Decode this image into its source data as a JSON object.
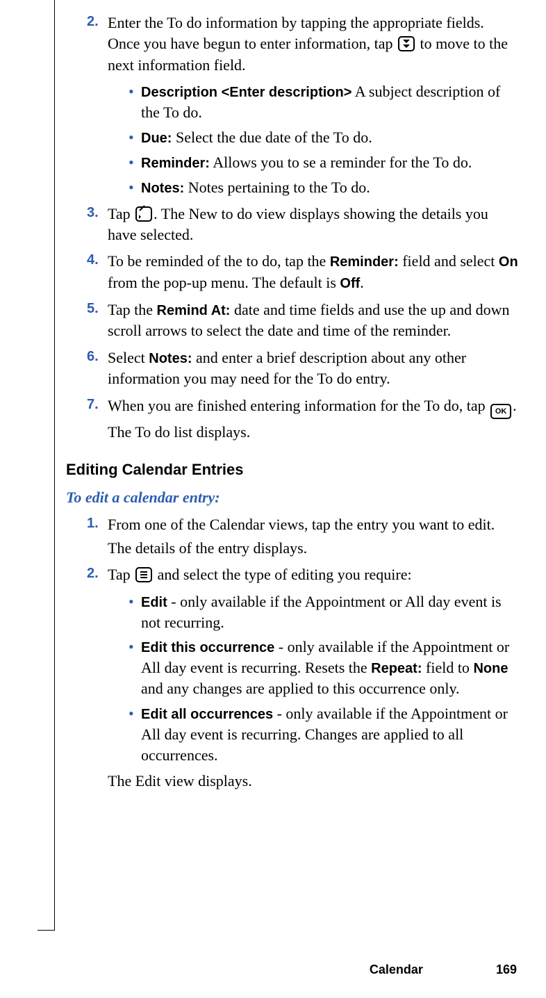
{
  "icons": {
    "ok": "OK"
  },
  "steps": {
    "s2": {
      "num": "2.",
      "text_a": "Enter the To do information by tapping the appropriate fields. Once you have begun to enter information, tap",
      "text_b": " to move to the next information field.",
      "bullets": {
        "b1": {
          "label": "Description <Enter description>",
          "text": " A subject description of the To do."
        },
        "b2": {
          "label": "Due:",
          "text": "  Select the due date of the To do."
        },
        "b3": {
          "label": "Reminder:",
          "text": " Allows you to se a reminder for the To do."
        },
        "b4": {
          "label": "Notes:",
          "text": " Notes pertaining to the To do."
        }
      }
    },
    "s3": {
      "num": "3.",
      "text_a": "Tap ",
      "text_b": ". The New to do view displays showing the details you have selected."
    },
    "s4": {
      "num": "4.",
      "text_a": "To be reminded of the to do, tap the ",
      "label_reminder": "Reminder:",
      "text_b": " field and select ",
      "label_on": "On",
      "text_c": " from the pop-up menu. The default is ",
      "label_off": "Off",
      "text_d": "."
    },
    "s5": {
      "num": "5.",
      "text_a": "Tap the ",
      "label_remind_at": "Remind At:",
      "text_b": " date and time fields and use the up and down scroll arrows to select the date and time of the reminder."
    },
    "s6": {
      "num": "6.",
      "text_a": "Select ",
      "label_notes": "Notes:",
      "text_b": " and enter a brief description about any other information you may need for the To do entry."
    },
    "s7": {
      "num": "7.",
      "text_a": "When you are finished entering information for the To do, tap ",
      "text_b": ".",
      "text_c": "The To do list displays."
    }
  },
  "section": {
    "editing_heading": "Editing Calendar Entries",
    "edit_task_heading": "To edit a calendar entry:"
  },
  "edit_steps": {
    "e1": {
      "num": "1.",
      "text_a": "From one of the Calendar views, tap the entry you want to edit.",
      "text_b": "The details of the entry displays."
    },
    "e2": {
      "num": "2.",
      "text_a": "Tap ",
      "text_b": " and select the type of editing you require:",
      "bullets": {
        "b1": {
          "label": "Edit",
          "text": " - only available if the Appointment or All day event is not recurring."
        },
        "b2": {
          "label": "Edit this occurrence",
          "text_a": " - only available if the Appointment or All day event is recurring. Resets the ",
          "label_repeat": "Repeat:",
          "text_b": " field to ",
          "label_none": "None",
          "text_c": " and any changes are applied to this occurrence only."
        },
        "b3": {
          "label": "Edit all occurrences",
          "text": " - only available if the Appointment or All day event is recurring. Changes are applied to all occurrences."
        }
      },
      "outro": "The Edit view displays."
    }
  },
  "footer": {
    "section": "Calendar",
    "page": "169"
  }
}
